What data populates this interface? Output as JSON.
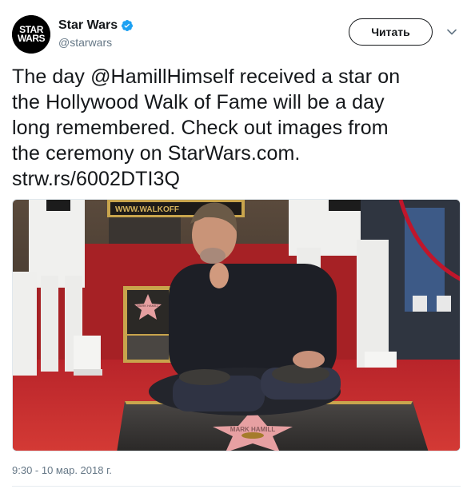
{
  "account": {
    "name": "Star Wars",
    "handle": "@starwars",
    "avatar_logo_text": [
      "STAR",
      "WARS"
    ],
    "verified": true,
    "verified_color": "#1da1f2"
  },
  "actions": {
    "follow_label": "Читать",
    "more_icon": "chevron-down-icon"
  },
  "tweet": {
    "lines": [
      {
        "parts": [
          {
            "text": "The day "
          },
          {
            "text": "@HamillHimself",
            "link": true
          },
          {
            "text": " received a star on"
          }
        ]
      },
      {
        "parts": [
          {
            "text": "the Hollywood Walk of Fame will be a day"
          }
        ]
      },
      {
        "parts": [
          {
            "text": "long remembered. Check out images from"
          }
        ]
      },
      {
        "parts": [
          {
            "text": "the ceremony on "
          },
          {
            "text": "StarWars.com",
            "link": true
          },
          {
            "text": "."
          }
        ]
      },
      {
        "parts": [
          {
            "text": "strw.rs/6002DTI3Q",
            "link": true
          }
        ]
      }
    ]
  },
  "media": {
    "sign_text": "WWW.WALKOFF",
    "star_name": "MARK HAMILL",
    "plaque_text": "MARK HAMILL"
  },
  "meta": {
    "timestamp": "9:30 - 10 мар. 2018 г."
  },
  "colors": {
    "text": "#14171a",
    "secondary": "#657786",
    "carpet": "#c0272d",
    "star": "#e8a5a5"
  }
}
